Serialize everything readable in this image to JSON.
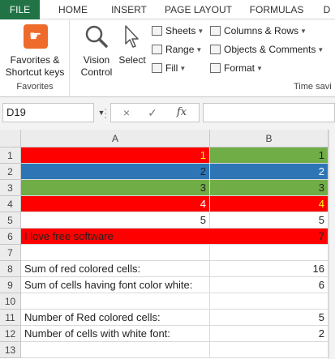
{
  "ribbon": {
    "tabs": [
      "FILE",
      "HOME",
      "INSERT",
      "PAGE LAYOUT",
      "FORMULAS",
      "D"
    ],
    "favorites": {
      "label_line1": "Favorites &",
      "label_line2": "Shortcut keys",
      "group_title": "Favorites"
    },
    "vision": {
      "line1": "Vision",
      "line2": "Control"
    },
    "select_label": "Select",
    "small_buttons": [
      "Sheets",
      "Range",
      "Fill",
      "Columns & Rows",
      "Objects & Comments",
      "Format"
    ],
    "time_group_title": "Time savi"
  },
  "formula_bar": {
    "name_box": "D19",
    "cancel": "×",
    "enter": "✓",
    "fx": "fx",
    "formula": ""
  },
  "grid": {
    "columns": [
      "A",
      "B"
    ],
    "rows": [
      {
        "num": "1",
        "a": "1",
        "b": "1"
      },
      {
        "num": "2",
        "a": "2",
        "b": "2"
      },
      {
        "num": "3",
        "a": "3",
        "b": "3"
      },
      {
        "num": "4",
        "a": "4",
        "b": "4"
      },
      {
        "num": "5",
        "a": "5",
        "b": "5"
      },
      {
        "num": "6",
        "a": "I love free software",
        "b": "7"
      },
      {
        "num": "7",
        "a": "",
        "b": ""
      },
      {
        "num": "8",
        "a": "Sum of red colored cells:",
        "b": "16"
      },
      {
        "num": "9",
        "a": "Sum of cells having font color white:",
        "b": "6"
      },
      {
        "num": "10",
        "a": "",
        "b": ""
      },
      {
        "num": "11",
        "a": "Number of Red colored cells:",
        "b": "5"
      },
      {
        "num": "12",
        "a": "Number of cells with white font:",
        "b": "2"
      },
      {
        "num": "13",
        "a": "",
        "b": ""
      }
    ]
  },
  "colors": {
    "file_tab": "#217346",
    "red_fill": "#ff0000",
    "green_fill": "#70ad47",
    "blue_fill": "#2e75b6",
    "yellow_font": "#ffff00",
    "white_font": "#ffffff"
  }
}
